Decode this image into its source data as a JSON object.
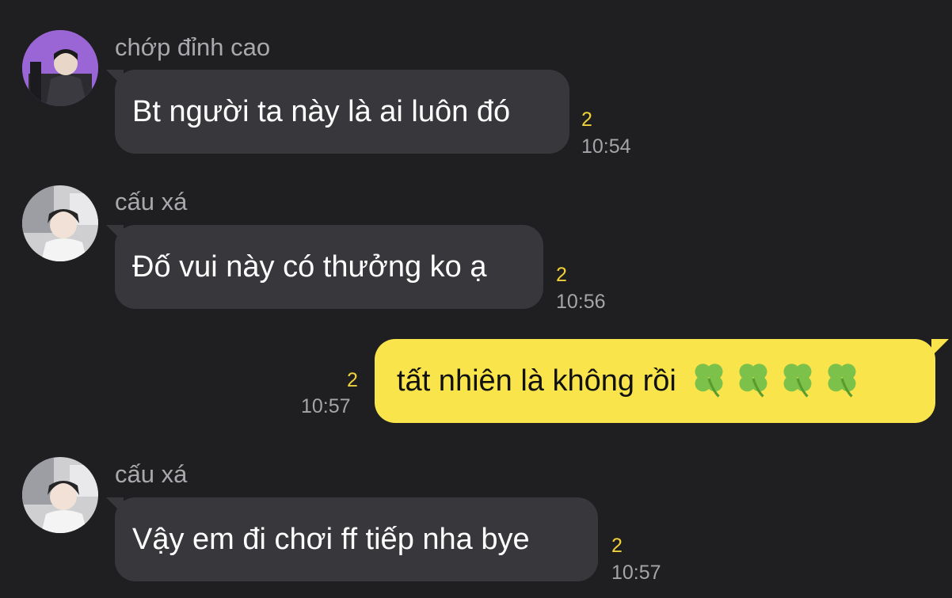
{
  "messages": [
    {
      "sender": "chớp đỉnh cao",
      "text": "Bt người ta này là ai luôn đó",
      "count": "2",
      "time": "10:54"
    },
    {
      "sender": "cấu xá",
      "text": "Đố vui này có thưởng ko ạ",
      "count": "2",
      "time": "10:56"
    },
    {
      "sender": "",
      "text": "tất nhiên là không rồi",
      "emoji": "🍀🍀🍀🍀",
      "count": "2",
      "time": "10:57"
    },
    {
      "sender": "cấu xá",
      "text": "Vậy em đi chơi ff tiếp nha bye",
      "count": "2",
      "time": "10:57"
    }
  ],
  "colors": {
    "background": "#1f1f21",
    "incoming_bubble": "#38383c",
    "outgoing_bubble": "#f9e54b",
    "unread_count": "#f0d13a",
    "timestamp": "#a5a5a9",
    "sender_name": "#a9a9ad"
  },
  "icons": {
    "clover": "four-leaf-clover-emoji"
  }
}
